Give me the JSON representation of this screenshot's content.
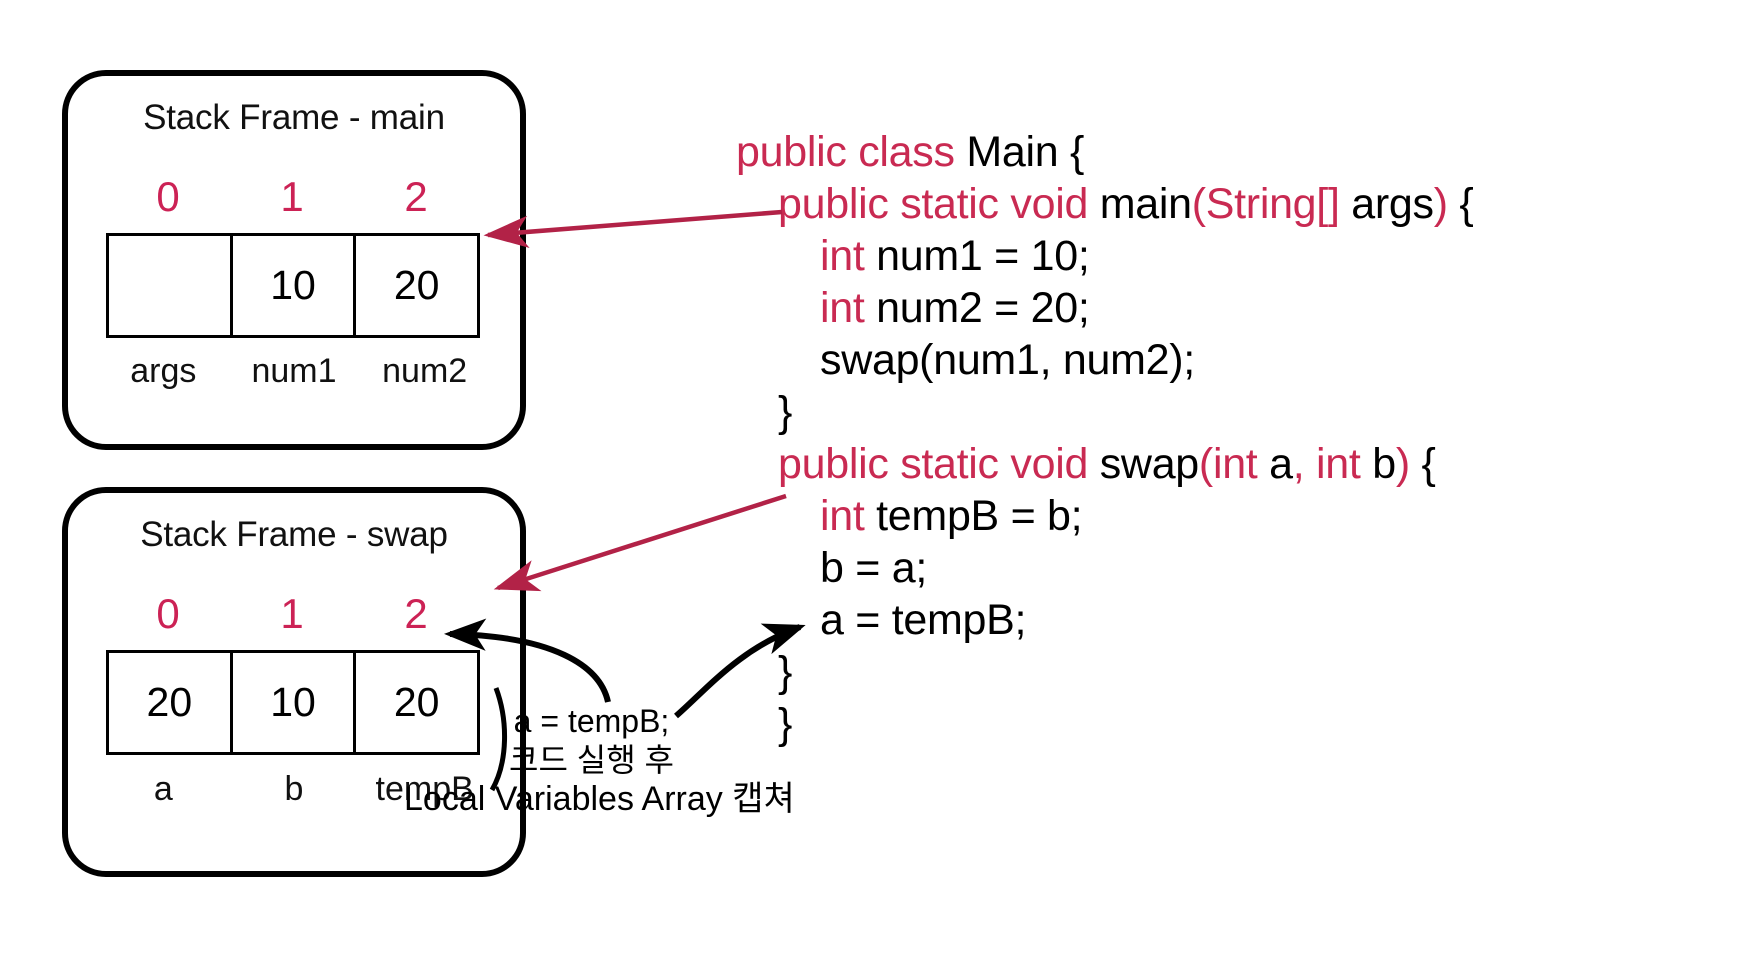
{
  "theme": {
    "background": "#ffffff",
    "ink": "#000000",
    "accent": "#c92a52",
    "arrow_accent": "#b22247"
  },
  "frames": [
    {
      "id": "main",
      "title": "Stack Frame - main",
      "indices": [
        "0",
        "1",
        "2"
      ],
      "values": [
        "",
        "10",
        "20"
      ],
      "names": [
        "args",
        "num1",
        "num2"
      ]
    },
    {
      "id": "swap",
      "title": "Stack Frame - swap",
      "indices": [
        "0",
        "1",
        "2"
      ],
      "values": [
        "20",
        "10",
        "20"
      ],
      "names": [
        "a",
        "b",
        "tempB"
      ]
    }
  ],
  "code": {
    "language": "java",
    "lines": [
      {
        "indent": 0,
        "tokens": [
          {
            "t": "public class ",
            "k": true
          },
          {
            "t": "Main {",
            "k": false
          }
        ]
      },
      {
        "indent": 1,
        "tokens": [
          {
            "t": "public static void ",
            "k": true
          },
          {
            "t": "main",
            "k": false
          },
          {
            "t": "(String[]",
            "k": true
          },
          {
            "t": " args",
            "k": false
          },
          {
            "t": ")",
            "k": true
          },
          {
            "t": " {",
            "k": false
          }
        ]
      },
      {
        "indent": 2,
        "tokens": [
          {
            "t": "int",
            "k": true
          },
          {
            "t": " num1 = 10;",
            "k": false
          }
        ]
      },
      {
        "indent": 2,
        "tokens": [
          {
            "t": "int",
            "k": true
          },
          {
            "t": " num2 = 20;",
            "k": false
          }
        ]
      },
      {
        "indent": 2,
        "tokens": [
          {
            "t": "swap(num1, num2);",
            "k": false
          }
        ]
      },
      {
        "indent": 1,
        "tokens": [
          {
            "t": "}",
            "k": false
          }
        ]
      },
      {
        "indent": 1,
        "tokens": [
          {
            "t": "public static void ",
            "k": true
          },
          {
            "t": "swap",
            "k": false
          },
          {
            "t": "(int",
            "k": true
          },
          {
            "t": " a",
            "k": false
          },
          {
            "t": ",",
            "k": true
          },
          {
            "t": " ",
            "k": false
          },
          {
            "t": "int",
            "k": true
          },
          {
            "t": " b",
            "k": false
          },
          {
            "t": ")",
            "k": true
          },
          {
            "t": " {",
            "k": false
          }
        ]
      },
      {
        "indent": 2,
        "tokens": [
          {
            "t": "int",
            "k": true
          },
          {
            "t": " tempB = b;",
            "k": false
          }
        ]
      },
      {
        "indent": 2,
        "tokens": [
          {
            "t": "b = a;",
            "k": false
          }
        ]
      },
      {
        "indent": 2,
        "tokens": [
          {
            "t": "a = tempB;",
            "k": false
          }
        ]
      },
      {
        "indent": 1,
        "tokens": [
          {
            "t": "}",
            "k": false
          }
        ]
      },
      {
        "indent": 1,
        "tokens": [
          {
            "t": "}",
            "k": false
          }
        ]
      }
    ]
  },
  "annotations": {
    "exec_note": "a = tempB;\n코드 실행 후",
    "capture_note": "Local Variables Array 캡쳐"
  }
}
